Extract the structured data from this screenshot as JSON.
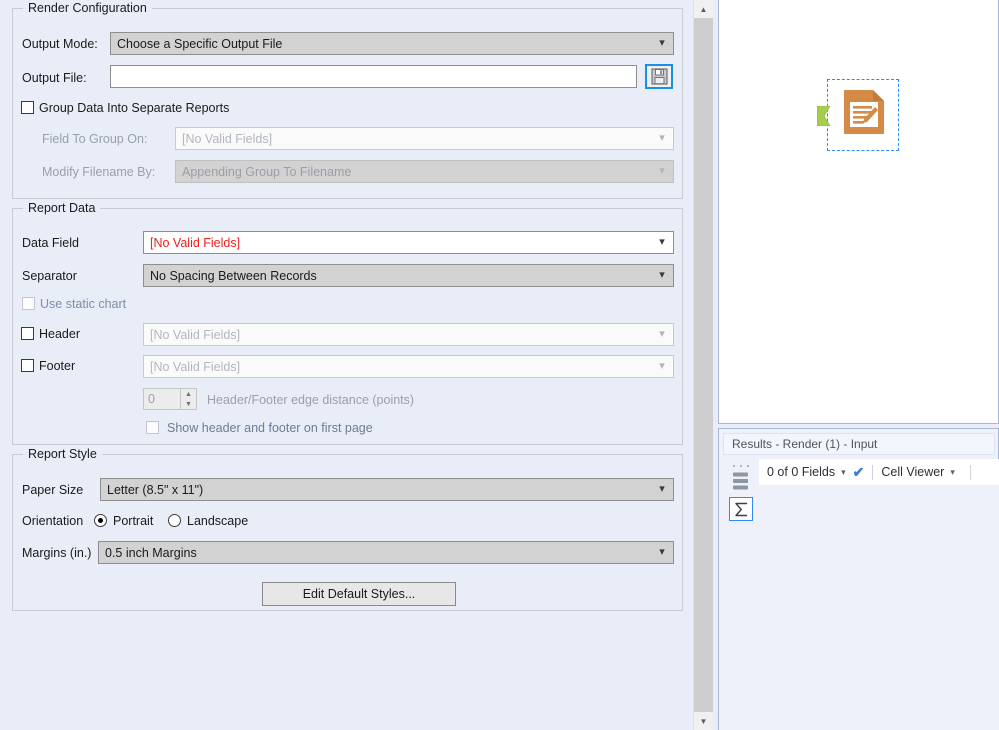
{
  "render_configuration": {
    "title": "Render Configuration",
    "output_mode_label": "Output Mode:",
    "output_mode_value": "Choose a Specific Output File",
    "output_file_label": "Output File:",
    "output_file_value": "",
    "save_icon": "floppy-disk-icon",
    "group_data_label": "Group Data Into Separate Reports",
    "group_data_checked": false,
    "field_to_group_label": "Field To Group On:",
    "field_to_group_value": "[No Valid Fields]",
    "modify_filename_label": "Modify Filename By:",
    "modify_filename_value": "Appending Group To Filename"
  },
  "report_data": {
    "title": "Report Data",
    "data_field_label": "Data Field",
    "data_field_value": "[No Valid Fields]",
    "data_field_color": "#f1201c",
    "separator_label": "Separator",
    "separator_value": "No Spacing Between Records",
    "use_static_chart_label": "Use static chart",
    "use_static_chart_checked": false,
    "header_label": "Header",
    "header_value": "[No Valid Fields]",
    "header_checked": false,
    "footer_label": "Footer",
    "footer_value": "[No Valid Fields]",
    "footer_checked": false,
    "edge_distance_value": "0",
    "edge_distance_label": "Header/Footer edge distance (points)",
    "show_header_footer_label": "Show header and footer on first page",
    "show_header_footer_checked": false
  },
  "report_style": {
    "title": "Report Style",
    "paper_size_label": "Paper Size",
    "paper_size_value": "Letter (8.5\" x 11\")",
    "orientation_label": "Orientation",
    "orientation_portrait": "Portrait",
    "orientation_landscape": "Landscape",
    "orientation_selected": "Portrait",
    "margins_label": "Margins (in.)",
    "margins_value": "0.5 inch Margins",
    "edit_default_styles_label": "Edit Default Styles..."
  },
  "scrollbar": {
    "up_arrow": "chevron-up-icon",
    "down_arrow": "chevron-down-icon"
  },
  "canvas": {
    "node_name": "render-tool-node",
    "node_icon": "report-document-icon",
    "input_plug": "input-connector-icon"
  },
  "results": {
    "title": "Results - Render (1) - Input",
    "fields_count_label": "0 of 0 Fields",
    "checkmark_icon": "checkmark-icon",
    "cell_viewer_label": "Cell Viewer",
    "dropdown_icon": "chevron-down-icon",
    "rail": {
      "grip": "grip-dots-icon",
      "stack_icon": "stacked-layers-icon",
      "sigma_icon": "sigma-icon",
      "sigma_label": "Σ"
    }
  },
  "colors": {
    "background": "#e9edf8",
    "accent_blue": "#2a8bf2",
    "error_red": "#f1201c",
    "node_orange": "#d38b46",
    "plug_green": "#a5cd4e"
  }
}
